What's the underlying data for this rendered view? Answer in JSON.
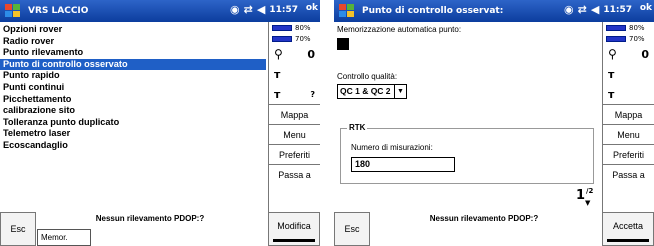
{
  "left": {
    "title": "VRS LACCIO",
    "time": "11:57",
    "ok": "ok",
    "menu_items": [
      {
        "label": "Opzioni rover",
        "selected": false
      },
      {
        "label": "Radio rover",
        "selected": false
      },
      {
        "label": "Punto rilevamento",
        "selected": false
      },
      {
        "label": "Punto di controllo osservato",
        "selected": true
      },
      {
        "label": "Punto rapido",
        "selected": false
      },
      {
        "label": "Punti continui",
        "selected": false
      },
      {
        "label": "Picchettamento",
        "selected": false
      },
      {
        "label": "calibrazione sito",
        "selected": false
      },
      {
        "label": "Tolleranza punto duplicato",
        "selected": false
      },
      {
        "label": "Telemetro laser",
        "selected": false
      },
      {
        "label": "Ecoscandaglio",
        "selected": false
      }
    ],
    "battery1": "80%",
    "battery2": "70%",
    "sat_count": "0",
    "rtk_count": "?",
    "side_buttons": [
      "Mappa",
      "Menu",
      "Preferiti",
      "Passa a"
    ],
    "status_msg": "Nessun rilevamento PDOP:?",
    "esc": "Esc",
    "memor": "Memor.",
    "modifica": "Modifica"
  },
  "right": {
    "title": "Punto di controllo osservat:",
    "time": "11:57",
    "ok": "ok",
    "auto_store_label": "Memorizzazione automatica punto:",
    "quality_label": "Controllo qualità:",
    "quality_value": "QC 1 & QC 2",
    "rtk_group": "RTK",
    "num_measure_label": "Numero di misurazioni:",
    "num_measure_value": "180",
    "page_num": "1",
    "page_total": "/2",
    "battery1": "80%",
    "battery2": "70%",
    "sat_count": "0",
    "side_buttons": [
      "Mappa",
      "Menu",
      "Preferiti",
      "Passa a"
    ],
    "status_msg": "Nessun rilevamento PDOP:?",
    "esc": "Esc",
    "accetta": "Accetta"
  },
  "colors": {
    "titlebar": "#1a4fb5",
    "selection": "#1f5fc6",
    "battery": "#2335c7"
  }
}
